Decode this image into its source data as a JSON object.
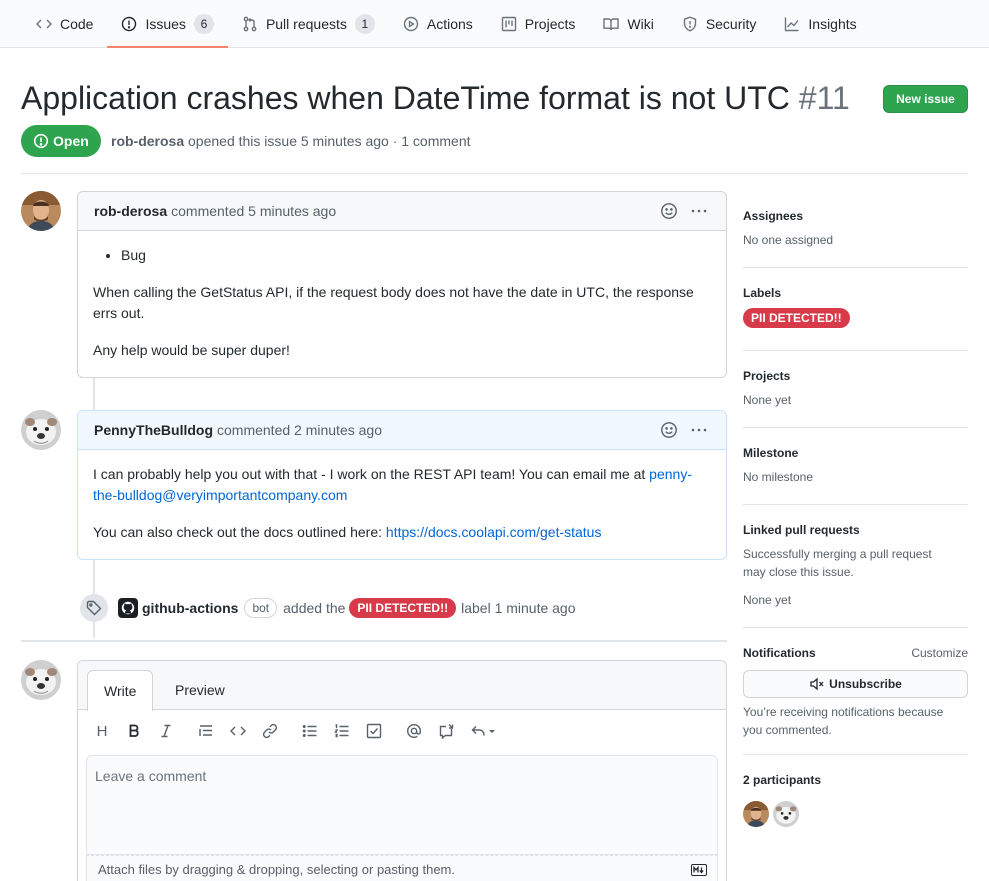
{
  "nav": {
    "items": [
      {
        "label": "Code",
        "icon": "code-icon"
      },
      {
        "label": "Issues",
        "icon": "issue-opened-icon",
        "count": "6"
      },
      {
        "label": "Pull requests",
        "icon": "git-pull-request-icon",
        "count": "1"
      },
      {
        "label": "Actions",
        "icon": "play-icon"
      },
      {
        "label": "Projects",
        "icon": "project-icon"
      },
      {
        "label": "Wiki",
        "icon": "book-icon"
      },
      {
        "label": "Security",
        "icon": "shield-icon"
      },
      {
        "label": "Insights",
        "icon": "graph-icon"
      }
    ],
    "active": "Issues"
  },
  "issue": {
    "title": "Application crashes when DateTime format is not UTC",
    "number": "#11",
    "state": "Open",
    "author": "rob-derosa",
    "meta_text": "opened this issue 5 minutes ago · 1 comment",
    "new_issue_label": "New issue"
  },
  "comments": [
    {
      "author": "rob-derosa",
      "action": "commented 5 minutes ago",
      "bullet": "Bug",
      "paragraphs": [
        "When calling the GetStatus API, if the request body does not have the date in UTC, the response errs out.",
        "Any help would be super duper!"
      ]
    },
    {
      "author": "PennyTheBulldog",
      "action": "commented 2 minutes ago",
      "p1_text": "I can probably help you out with that - I work on the REST API team! You can email me at",
      "p1_link": "penny-the-bulldog@veryimportantcompany.com",
      "p2_text": "You can also check out the docs outlined here:",
      "p2_link": "https://docs.coolapi.com/get-status"
    }
  ],
  "event": {
    "actor": "github-actions",
    "bot_badge": "bot",
    "action": "added the",
    "label": "PII DETECTED!!",
    "suffix": "label 1 minute ago"
  },
  "composer": {
    "tabs": [
      "Write",
      "Preview"
    ],
    "placeholder": "Leave a comment",
    "drop_hint": "Attach files by dragging & dropping, selecting or pasting them.",
    "toolbar_heading": "H"
  },
  "sidebar": {
    "assignees": {
      "heading": "Assignees",
      "value": "No one assigned"
    },
    "labels": {
      "heading": "Labels",
      "value": "PII DETECTED!!"
    },
    "projects": {
      "heading": "Projects",
      "value": "None yet"
    },
    "milestone": {
      "heading": "Milestone",
      "value": "No milestone"
    },
    "linked": {
      "heading": "Linked pull requests",
      "line1": "Successfully merging a pull request",
      "line2": "may close this issue.",
      "value": "None yet"
    },
    "notifications": {
      "heading": "Notifications",
      "customize": "Customize",
      "button": "Unsubscribe",
      "line1": "You’re receiving notifications because",
      "line2": "you commented."
    },
    "participants": {
      "heading": "2 participants"
    }
  },
  "colors": {
    "open_green": "#2ea44f",
    "label_red": "#d73a49",
    "link_blue": "#0366d6",
    "nav_underline": "#f9826c"
  }
}
